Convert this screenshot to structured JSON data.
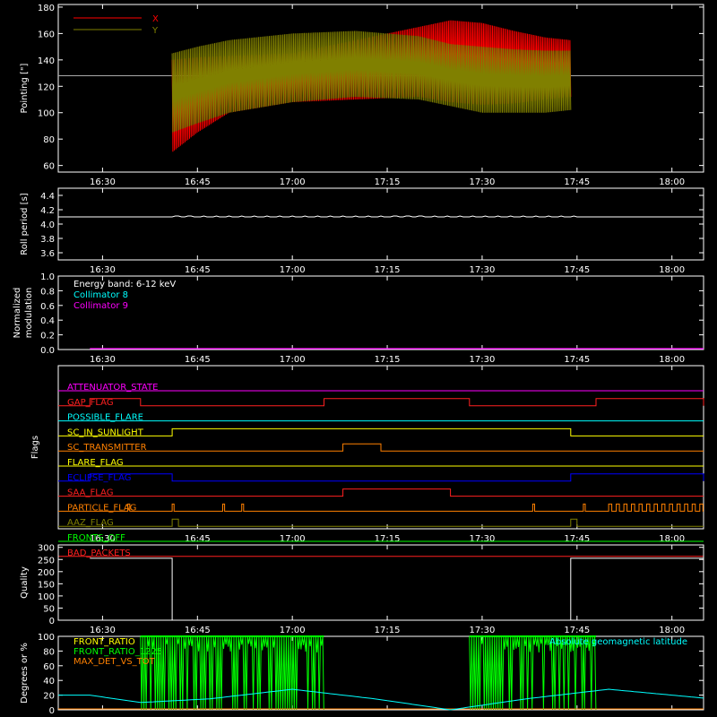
{
  "time_axis": {
    "ticks": [
      "16:30",
      "16:45",
      "17:00",
      "17:15",
      "17:30",
      "17:45",
      "18:00"
    ],
    "tick_minutes": [
      990,
      1005,
      1020,
      1035,
      1050,
      1065,
      1080
    ],
    "range_minutes": [
      983,
      1085
    ]
  },
  "chart_data": [
    {
      "id": "pointing",
      "type": "line",
      "ylabel": "Pointing [\"]",
      "ylim": [
        55,
        182
      ],
      "yticks": [
        60,
        80,
        100,
        120,
        140,
        160,
        180
      ],
      "legend_placement": "top-left",
      "series": [
        {
          "name": "X",
          "color": "#ff0000",
          "x": [
            "16:41",
            "16:45",
            "16:50",
            "17:00",
            "17:10",
            "17:20",
            "17:25",
            "17:30",
            "17:35",
            "17:40",
            "17:44"
          ],
          "y_max": [
            140,
            142,
            143,
            145,
            155,
            165,
            170,
            168,
            162,
            157,
            155
          ],
          "y_min": [
            70,
            85,
            100,
            108,
            110,
            112,
            108,
            106,
            107,
            110,
            112
          ]
        },
        {
          "name": "Y",
          "color": "#808000",
          "x": [
            "16:41",
            "16:45",
            "16:50",
            "17:00",
            "17:10",
            "17:20",
            "17:25",
            "17:30",
            "17:35",
            "17:40",
            "17:44"
          ],
          "y_max": [
            145,
            150,
            155,
            160,
            162,
            158,
            152,
            150,
            148,
            147,
            147
          ],
          "y_min": [
            85,
            92,
            100,
            108,
            112,
            110,
            105,
            100,
            100,
            100,
            102
          ]
        }
      ],
      "reference_line": {
        "y": 128,
        "color": "#aaaaaa"
      }
    },
    {
      "id": "roll-period",
      "type": "line",
      "ylabel": "Roll period [s]",
      "ylim": [
        3.5,
        4.5
      ],
      "yticks": [
        "3.6",
        "3.8",
        "4.0",
        "4.2",
        "4.4"
      ],
      "series": [
        {
          "x": [
            "16:28",
            "17:00",
            "17:45",
            "18:05"
          ],
          "y": [
            4.1,
            4.1,
            4.1,
            4.1
          ],
          "color": "#ffffff"
        }
      ]
    },
    {
      "id": "modulation",
      "type": "line",
      "ylabel": "Normalized modulation",
      "ylim": [
        0.0,
        1.0
      ],
      "yticks": [
        "0.0",
        "0.2",
        "0.4",
        "0.6",
        "0.8",
        "1.0"
      ],
      "annotations": [
        {
          "text": "Energy band: 6-12 keV",
          "color": "#ffffff"
        },
        {
          "text": "Collimator 8",
          "color": "#00ffff"
        },
        {
          "text": "Collimator 9",
          "color": "#ff00ff"
        }
      ],
      "series": [
        {
          "name": "Collimator 9",
          "x": [
            "16:28",
            "18:05"
          ],
          "y": [
            0.0,
            0.0
          ],
          "color": "#ff00ff"
        }
      ]
    },
    {
      "id": "flags",
      "type": "line",
      "ylabel": "Flags",
      "series": [
        {
          "name": "ATTENUATOR_STATE",
          "color": "#ff00ff",
          "on": []
        },
        {
          "name": "GAP_FLAG",
          "color": "#ff2020",
          "on": [
            [
              "16:28",
              "16:36"
            ],
            [
              "17:05",
              "17:28"
            ],
            [
              "17:48",
              "18:05"
            ]
          ]
        },
        {
          "name": "POSSIBLE_FLARE",
          "color": "#00ffff",
          "on": []
        },
        {
          "name": "SC_IN_SUNLIGHT",
          "color": "#ffff00",
          "on": [
            [
              "16:41",
              "17:44"
            ]
          ]
        },
        {
          "name": "SC_TRANSMITTER",
          "color": "#ff8000",
          "on": [
            [
              "17:08",
              "17:14"
            ]
          ]
        },
        {
          "name": "FLARE_FLAG",
          "color": "#ffff00",
          "on": []
        },
        {
          "name": "ECLIPSE_FLAG",
          "color": "#0000ff",
          "on": [
            [
              "16:28",
              "16:41"
            ],
            [
              "17:44",
              "18:05"
            ]
          ]
        },
        {
          "name": "SAA_FLAG",
          "color": "#ff2020",
          "on": [
            [
              "17:08",
              "17:25"
            ]
          ]
        },
        {
          "name": "PARTICLE_FLAG",
          "color": "#ff8000",
          "on": []
        },
        {
          "name": "AAZ_FLAG",
          "color": "#808000",
          "on": [
            [
              "16:41",
              "16:42"
            ],
            [
              "17:44",
              "17:45"
            ]
          ]
        },
        {
          "name": "FRONTS_OFF",
          "color": "#00ff00",
          "on": []
        },
        {
          "name": "BAD_PACKETS",
          "color": "#ff2020",
          "on": []
        }
      ]
    },
    {
      "id": "quality",
      "type": "line",
      "ylabel": "Quality",
      "ylim": [
        0,
        310
      ],
      "yticks": [
        0,
        50,
        100,
        150,
        200,
        250,
        300
      ],
      "series": [
        {
          "x": [
            "16:28",
            "16:41",
            "16:41",
            "17:44",
            "17:44",
            "18:05"
          ],
          "y": [
            255,
            255,
            0,
            0,
            255,
            255
          ],
          "color": "#ffffff"
        }
      ]
    },
    {
      "id": "ratios",
      "type": "line",
      "ylabel": "Degrees or %",
      "ylim": [
        0,
        100
      ],
      "yticks": [
        0,
        20,
        40,
        60,
        80,
        100
      ],
      "legend": [
        {
          "name": "FRONT_RATIO",
          "color": "#ffff00"
        },
        {
          "name": "FRONT_RATIO_1225",
          "color": "#00ff00"
        },
        {
          "name": "MAX_DET_VS_TOT",
          "color": "#ff8000"
        }
      ],
      "right_annotation": {
        "text": "Absolute geomagnetic latitude",
        "color": "#00ffff"
      },
      "green_bands": [
        [
          "16:36",
          "17:05"
        ],
        [
          "17:28",
          "17:48"
        ]
      ],
      "geomagnetic": {
        "color": "#00ffff",
        "x": [
          "16:28",
          "16:36",
          "16:47",
          "17:00",
          "17:13",
          "17:25",
          "17:37",
          "17:50",
          "18:05"
        ],
        "y": [
          20,
          10,
          15,
          28,
          15,
          0,
          15,
          28,
          16
        ]
      }
    }
  ]
}
